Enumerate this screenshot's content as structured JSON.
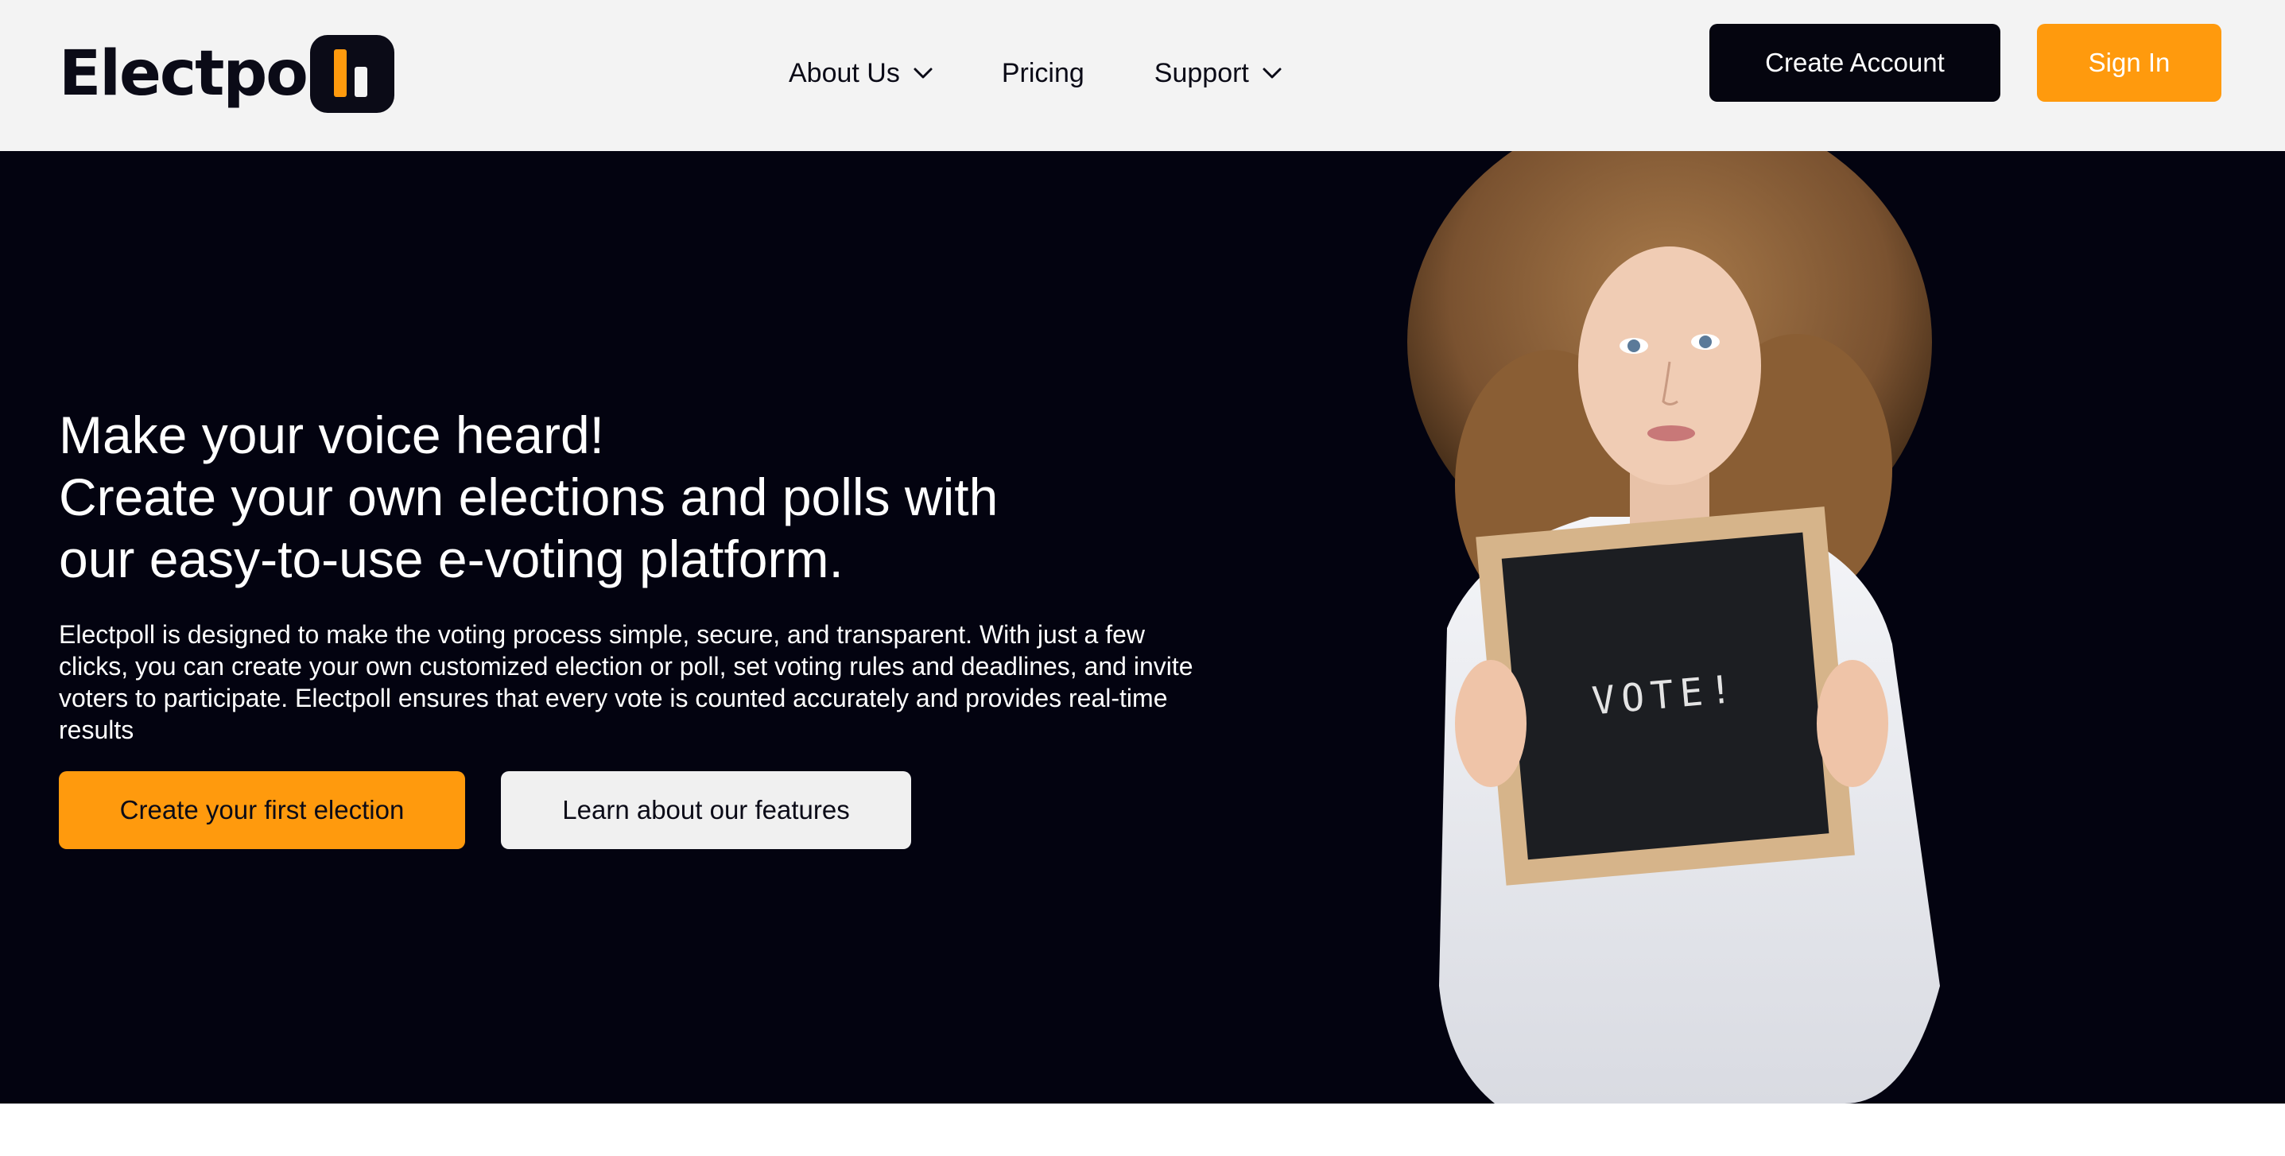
{
  "header": {
    "logo_text": "Electpo",
    "nav": {
      "about_label": "About Us",
      "pricing_label": "Pricing",
      "support_label": "Support"
    },
    "create_account_label": "Create Account",
    "sign_in_label": "Sign In"
  },
  "hero": {
    "title_lines": [
      "Make your voice heard!",
      "Create your own elections and polls with",
      "our easy-to-use e-voting platform."
    ],
    "description": "Electpoll is designed to make the voting process simple, secure, and transparent. With just a few clicks, you can create your own customized election or poll, set voting rules and deadlines, and invite voters to participate. Electpoll ensures that every vote is counted accurately and provides real-time results",
    "primary_button_label": "Create your first election",
    "secondary_button_label": "Learn about our features",
    "image_sign_text": "VOTE!"
  },
  "colors": {
    "accent": "#ff9a0d",
    "dark": "#030310",
    "header_bg": "#f3f3f3",
    "light_button": "#f0f0f0"
  },
  "icons": {
    "dropdown": "chevron-down-icon",
    "logo_mark": "bar-chart-logo-icon"
  }
}
